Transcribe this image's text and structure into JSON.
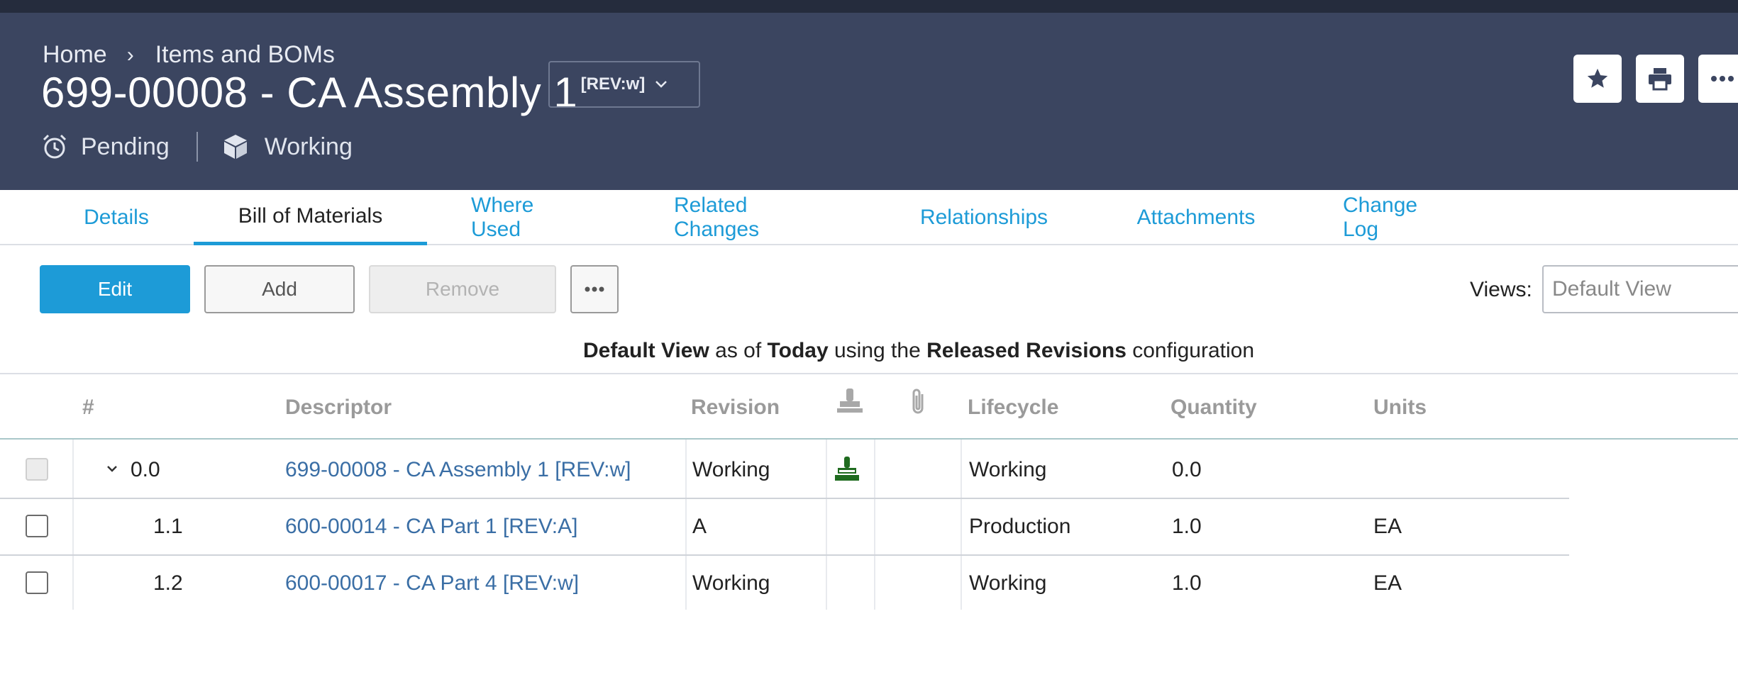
{
  "header": {
    "breadcrumb": {
      "home": "Home",
      "separator": "›",
      "current": "Items and BOMs"
    },
    "title": "699-00008 - CA Assembly 1",
    "revision_button": "[REV:w]",
    "status_pending": "Pending",
    "status_working": "Working",
    "actions": {
      "favorite_icon": "star-icon",
      "print_icon": "print-icon",
      "more_icon": "more-icon"
    },
    "colors": {
      "background": "#3b4560",
      "top_strip": "#252c3d"
    }
  },
  "tabs": [
    {
      "label": "Details"
    },
    {
      "label": "Bill of Materials",
      "active": true
    },
    {
      "label": "Where Used"
    },
    {
      "label": "Related Changes"
    },
    {
      "label": "Relationships"
    },
    {
      "label": "Attachments"
    },
    {
      "label": "Change Log"
    }
  ],
  "toolbar": {
    "edit_label": "Edit",
    "add_label": "Add",
    "remove_label": "Remove",
    "views_label": "Views:",
    "views_value": "Default View"
  },
  "caption": {
    "view": "Default View",
    "as_of_text": " as of ",
    "date": "Today",
    "using_text": " using the ",
    "config": "Released Revisions",
    "suffix": " configuration"
  },
  "table": {
    "columns": {
      "number": "#",
      "descriptor": "Descriptor",
      "revision": "Revision",
      "lifecycle": "Lifecycle",
      "quantity": "Quantity",
      "units": "Units"
    },
    "rows": [
      {
        "number": "0.0",
        "descriptor": "699-00008 - CA Assembly 1 [REV:w]",
        "revision": "Working",
        "lifecycle": "Working",
        "quantity": "0.0",
        "units": "",
        "expandable": true,
        "has_stamp": true,
        "checkbox_disabled": true
      },
      {
        "number": "1.1",
        "descriptor": "600-00014 - CA Part 1 [REV:A]",
        "revision": "A",
        "lifecycle": "Production",
        "quantity": "1.0",
        "units": "EA"
      },
      {
        "number": "1.2",
        "descriptor": "600-00017 - CA Part 4 [REV:w]",
        "revision": "Working",
        "lifecycle": "Working",
        "quantity": "1.0",
        "units": "EA"
      }
    ]
  },
  "colors": {
    "accent": "#1d9bd7",
    "link": "#3a6ea5",
    "stamp_green": "#1f6b1f"
  }
}
